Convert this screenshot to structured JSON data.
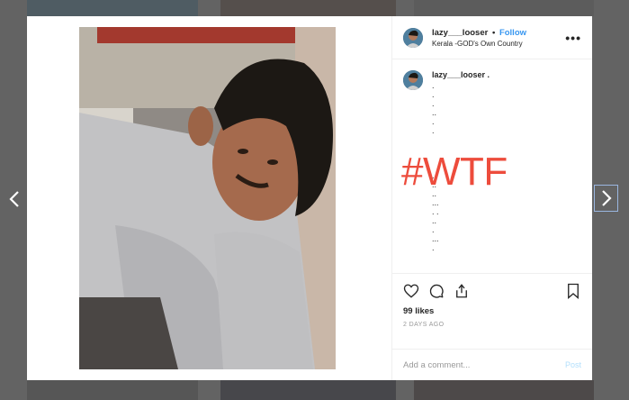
{
  "post": {
    "username": "lazy___looser",
    "separator": "•",
    "follow_label": "Follow",
    "location": "Kerala -GOD's Own Country",
    "more_icon": "more-horizontal-icon"
  },
  "caption": {
    "username": "lazy___looser .",
    "lines": [
      ".",
      ".",
      ".",
      "..",
      ".",
      ".",
      "",
      "",
      "",
      "",
      ".",
      "..",
      "..",
      "...",
      ". .",
      "..",
      ".",
      "...",
      "."
    ],
    "hashtag": "#WTF"
  },
  "actions": {
    "icons": [
      "heart-icon",
      "comment-icon",
      "share-icon",
      "bookmark-icon"
    ],
    "likes": "99 likes",
    "time": "2 DAYS AGO"
  },
  "comment": {
    "placeholder": "Add a comment...",
    "post_label": "Post"
  },
  "colors": {
    "follow": "#3897f0",
    "hashtag": "#ed4c3c",
    "post_disabled": "#b2dffc"
  }
}
